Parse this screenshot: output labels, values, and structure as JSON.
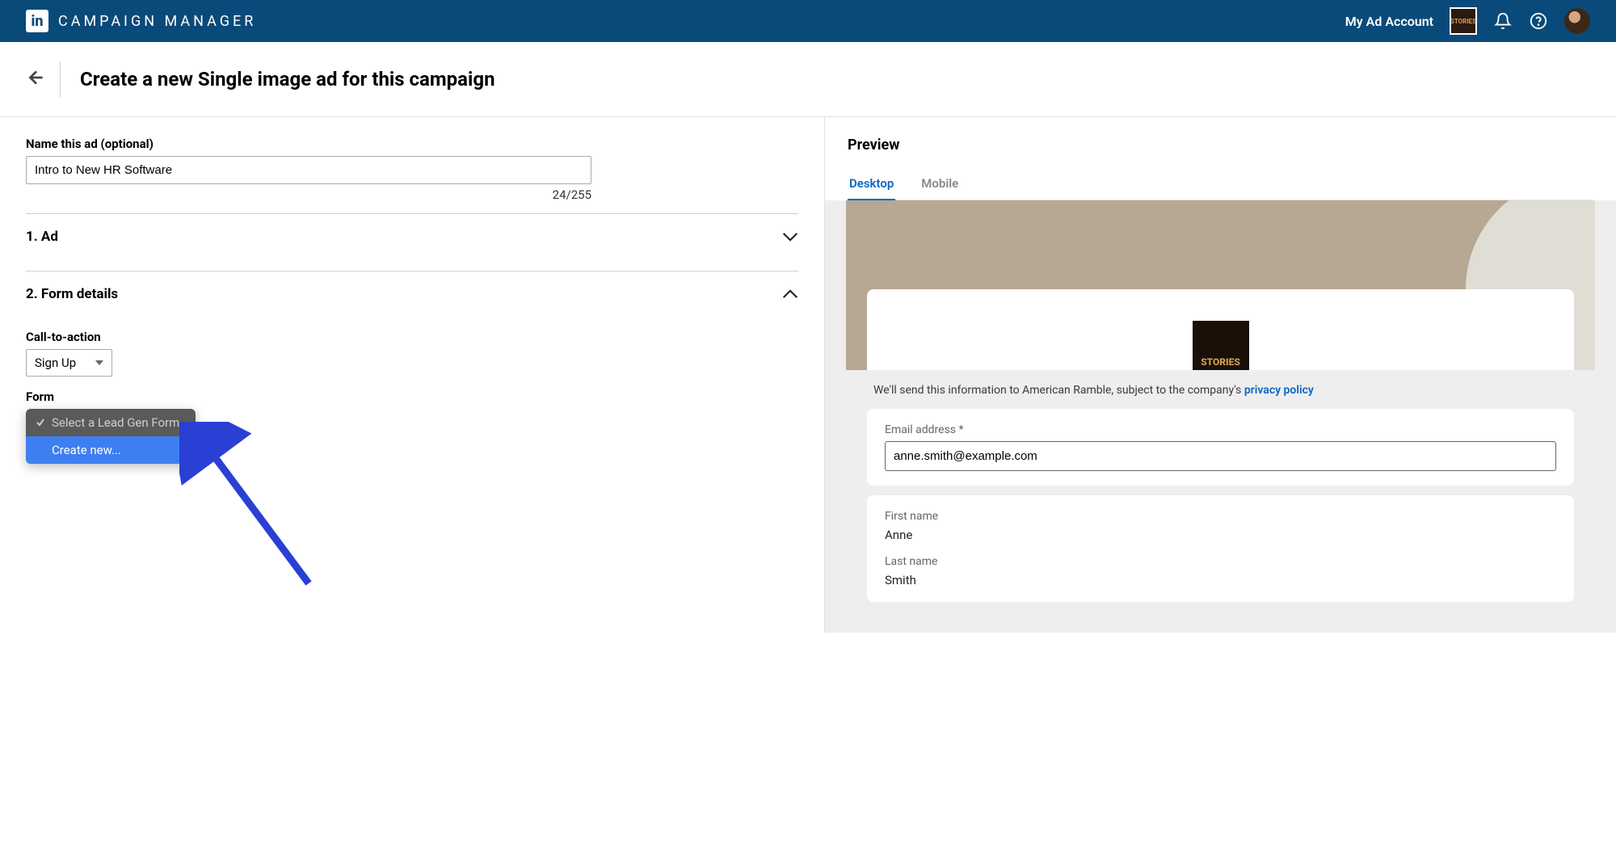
{
  "topbar": {
    "brand": "CAMPAIGN MANAGER",
    "account_label": "My Ad Account",
    "account_logo_text": "STORIES"
  },
  "page": {
    "title": "Create a new Single image ad for this campaign"
  },
  "form": {
    "name_label": "Name this ad (optional)",
    "name_value": "Intro to New HR Software",
    "char_count": "24/255",
    "section1": "1.   Ad",
    "section2": "2.   Form details",
    "cta_label": "Call-to-action",
    "cta_value": "Sign Up",
    "form_label": "Form",
    "dropdown": {
      "option1": "Select a Lead Gen Form",
      "option2": "Create new..."
    }
  },
  "preview": {
    "title": "Preview",
    "tab_desktop": "Desktop",
    "tab_mobile": "Mobile",
    "banner_logo_text": "STORIES",
    "legal_prefix": "We'll send this information to American Ramble, subject to the company's ",
    "legal_link": "privacy policy",
    "email_label": "Email address *",
    "email_value": "anne.smith@example.com",
    "first_name_label": "First name",
    "first_name_value": "Anne",
    "last_name_label": "Last name",
    "last_name_value": "Smith"
  }
}
